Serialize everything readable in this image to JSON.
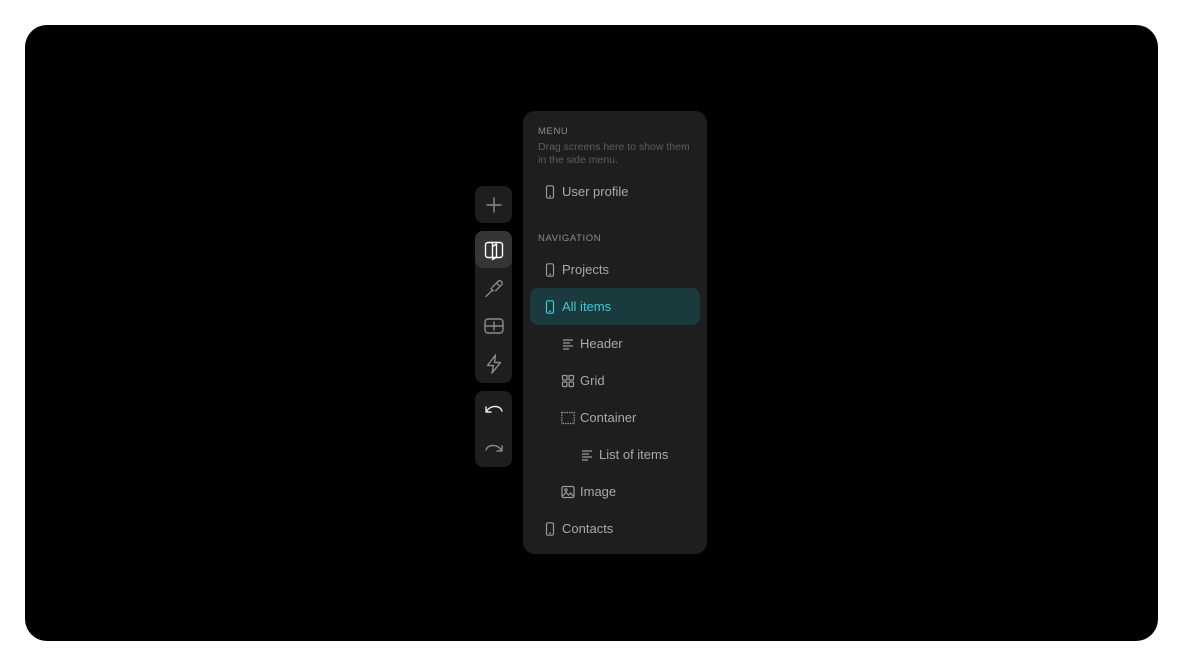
{
  "toolbar": {
    "add": {
      "icon": "plus-icon"
    },
    "main": [
      {
        "icon": "layout-panels-icon",
        "active": true
      },
      {
        "icon": "brush-icon",
        "active": false
      },
      {
        "icon": "table-icon",
        "active": false
      },
      {
        "icon": "lightning-icon",
        "active": false
      }
    ],
    "history": [
      {
        "icon": "undo-icon"
      },
      {
        "icon": "redo-icon"
      }
    ]
  },
  "menu_section": {
    "title": "MENU",
    "description": "Drag screens here to show them in the side menu.",
    "items": [
      {
        "label": "User profile",
        "icon": "phone-screen-icon"
      }
    ]
  },
  "navigation_section": {
    "title": "NAVIGATION",
    "items": [
      {
        "label": "Projects",
        "icon": "phone-screen-icon",
        "level": 0
      },
      {
        "label": "All items",
        "icon": "phone-screen-icon",
        "level": 0,
        "selected": true
      },
      {
        "label": "Header",
        "icon": "text-align-icon",
        "level": 1
      },
      {
        "label": "Grid",
        "icon": "grid-icon",
        "level": 1
      },
      {
        "label": "Container",
        "icon": "container-icon",
        "level": 1
      },
      {
        "label": "List of items",
        "icon": "text-align-icon",
        "level": 2
      },
      {
        "label": "Image",
        "icon": "image-icon",
        "level": 1
      },
      {
        "label": "Contacts",
        "icon": "phone-screen-icon",
        "level": 0
      }
    ]
  },
  "colors": {
    "accent": "#3ec9d6",
    "selected_bg": "#1a3a3e",
    "panel_bg": "#1e1e1e",
    "canvas_bg": "#000000"
  }
}
